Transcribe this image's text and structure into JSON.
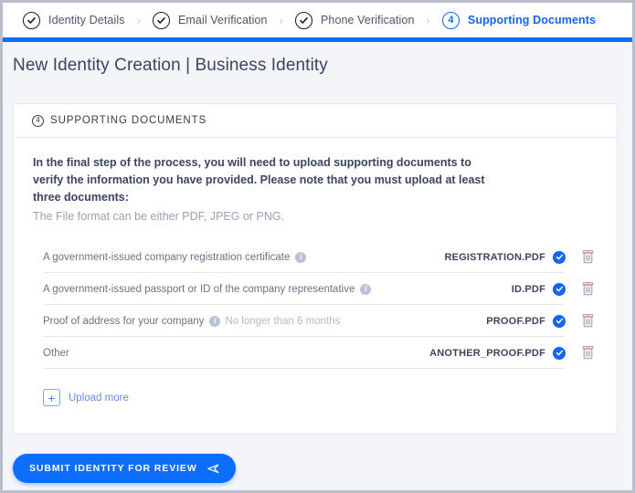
{
  "window": {
    "accent_color": "#0d6efd",
    "frame_border_color": "#b9bec9",
    "background": "#f4f5f9"
  },
  "stepper": {
    "separator": "›",
    "steps": [
      {
        "label": "Identity Details",
        "state": "completed",
        "icon": "check-circle-icon",
        "number": "1"
      },
      {
        "label": "Email Verification",
        "state": "completed",
        "icon": "check-circle-icon",
        "number": "2"
      },
      {
        "label": "Phone Verification",
        "state": "completed",
        "icon": "check-circle-icon",
        "number": "3"
      },
      {
        "label": "Supporting Documents",
        "state": "current",
        "icon": "number-circle-icon",
        "number": "4"
      }
    ]
  },
  "page": {
    "title": "New Identity Creation | Business Identity"
  },
  "card": {
    "header": {
      "step_number": "4",
      "label": "SUPPORTING DOCUMENTS"
    },
    "intro": {
      "bold": "In the final step of the process, you will need to upload supporting documents to verify the information you have provided. Please note that you must upload at least three documents:",
      "sub": "The File format can be either PDF, JPEG or PNG."
    },
    "documents": [
      {
        "label": "A government-issued company registration certificate",
        "has_info_icon": true,
        "hint": "",
        "file_name": "REGISTRATION.PDF",
        "status": "uploaded",
        "status_icon": "check-circle-filled-icon",
        "delete_icon": "trash-icon"
      },
      {
        "label": "A government-issued passport or ID of the company representative",
        "has_info_icon": true,
        "hint": "",
        "file_name": "ID.PDF",
        "status": "uploaded",
        "status_icon": "check-circle-filled-icon",
        "delete_icon": "trash-icon"
      },
      {
        "label": "Proof of address for your company",
        "has_info_icon": true,
        "hint": "No longer than 6 months",
        "file_name": "PROOF.PDF",
        "status": "uploaded",
        "status_icon": "check-circle-filled-icon",
        "delete_icon": "trash-icon"
      },
      {
        "label": "Other",
        "has_info_icon": false,
        "hint": "",
        "file_name": "ANOTHER_PROOF.PDF",
        "status": "uploaded",
        "status_icon": "check-circle-filled-icon",
        "delete_icon": "trash-icon"
      }
    ],
    "upload_more": {
      "plus_glyph": "+",
      "label": "Upload more"
    }
  },
  "footer": {
    "submit_label": "SUBMIT IDENTITY FOR REVIEW",
    "submit_icon": "send-arrow-icon"
  }
}
